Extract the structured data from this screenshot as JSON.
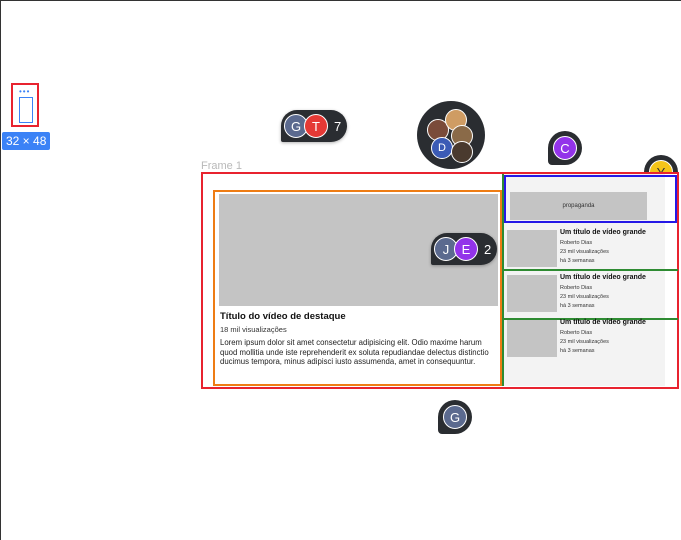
{
  "canvas": {
    "frame_label": "Frame 1",
    "size_badge": "32 × 48"
  },
  "collaborators": {
    "group_top": {
      "avatars": [
        "G",
        "T"
      ],
      "count": "7",
      "colors": [
        "#5b6a8f",
        "#e53935"
      ]
    },
    "group_mid": {
      "avatars": [
        "J",
        "E"
      ],
      "count": "2",
      "colors": [
        "#5b6a8f",
        "#9333ea"
      ]
    },
    "c_user": {
      "letter": "C",
      "color": "#9333ea"
    },
    "g_user": {
      "letter": "G",
      "color": "#5b6a8f"
    },
    "y_user": {
      "letter": "Y",
      "color": "#f5c518"
    },
    "photo_group": {
      "letter": "D",
      "color": "#3b5bb5"
    }
  },
  "featured": {
    "title": "Título do vídeo de destaque",
    "views": "18 mil visualizações",
    "description": "Lorem ipsum dolor sit amet consectetur adipisicing elit. Odio maxime harum quod mollitia unde iste reprehenderit ex soluta repudiandae delectus distinctio ducimus tempora, minus adipisci iusto assumenda, amet in consequuntur."
  },
  "ad": {
    "label": "propaganda"
  },
  "videos": [
    {
      "title": "Um título de vídeo grande",
      "author": "Roberto Dias",
      "views": "23  mil visualizações",
      "date": "há 3 semanas"
    },
    {
      "title": "Um título de vídeo grande",
      "author": "Roberto Dias",
      "views": "23  mil visualizações",
      "date": "há 3 semanas"
    },
    {
      "title": "Um título de vídeo grande",
      "author": "Roberto Dias",
      "views": "23  mil visualizações",
      "date": "há 3 semanas"
    }
  ]
}
